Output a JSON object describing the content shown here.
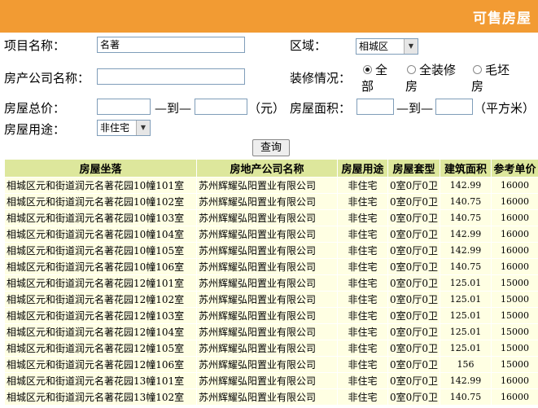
{
  "header": {
    "title": "可售房屋"
  },
  "form": {
    "project_name": {
      "label": "项目名称：",
      "value": "名著"
    },
    "region": {
      "label": "区域：",
      "value": "相城区"
    },
    "company": {
      "label": "房产公司名称：",
      "value": ""
    },
    "decoration": {
      "label": "装修情况：",
      "options": [
        {
          "line1": "全",
          "line2": "部",
          "selected": true
        },
        {
          "line1": "全装修",
          "line2": "房",
          "selected": false
        },
        {
          "line1": "毛坯",
          "line2": "房",
          "selected": false
        }
      ]
    },
    "total_price": {
      "label": "房屋总价：",
      "to": "—到—",
      "unit": "（元）",
      "min": "",
      "max": ""
    },
    "area": {
      "label": "房屋面积：",
      "to": "—到—",
      "unit": "（平方米）",
      "min": "",
      "max": ""
    },
    "usage": {
      "label": "房屋用途：",
      "value": "非住宅"
    },
    "search_button": "查询"
  },
  "table": {
    "headers": [
      "房屋坐落",
      "房地产公司名称",
      "房屋用途",
      "房屋套型",
      "建筑面积",
      "参考单价"
    ],
    "rows": [
      [
        "相城区元和街道润元名著花园10幢101室",
        "苏州辉耀弘阳置业有限公司",
        "非住宅",
        "0室0厅0卫",
        "142.99",
        "16000"
      ],
      [
        "相城区元和街道润元名著花园10幢102室",
        "苏州辉耀弘阳置业有限公司",
        "非住宅",
        "0室0厅0卫",
        "140.75",
        "16000"
      ],
      [
        "相城区元和街道润元名著花园10幢103室",
        "苏州辉耀弘阳置业有限公司",
        "非住宅",
        "0室0厅0卫",
        "140.75",
        "16000"
      ],
      [
        "相城区元和街道润元名著花园10幢104室",
        "苏州辉耀弘阳置业有限公司",
        "非住宅",
        "0室0厅0卫",
        "142.99",
        "16000"
      ],
      [
        "相城区元和街道润元名著花园10幢105室",
        "苏州辉耀弘阳置业有限公司",
        "非住宅",
        "0室0厅0卫",
        "142.99",
        "16000"
      ],
      [
        "相城区元和街道润元名著花园10幢106室",
        "苏州辉耀弘阳置业有限公司",
        "非住宅",
        "0室0厅0卫",
        "140.75",
        "16000"
      ],
      [
        "相城区元和街道润元名著花园12幢101室",
        "苏州辉耀弘阳置业有限公司",
        "非住宅",
        "0室0厅0卫",
        "125.01",
        "15000"
      ],
      [
        "相城区元和街道润元名著花园12幢102室",
        "苏州辉耀弘阳置业有限公司",
        "非住宅",
        "0室0厅0卫",
        "125.01",
        "15000"
      ],
      [
        "相城区元和街道润元名著花园12幢103室",
        "苏州辉耀弘阳置业有限公司",
        "非住宅",
        "0室0厅0卫",
        "125.01",
        "15000"
      ],
      [
        "相城区元和街道润元名著花园12幢104室",
        "苏州辉耀弘阳置业有限公司",
        "非住宅",
        "0室0厅0卫",
        "125.01",
        "15000"
      ],
      [
        "相城区元和街道润元名著花园12幢105室",
        "苏州辉耀弘阳置业有限公司",
        "非住宅",
        "0室0厅0卫",
        "125.01",
        "15000"
      ],
      [
        "相城区元和街道润元名著花园12幢106室",
        "苏州辉耀弘阳置业有限公司",
        "非住宅",
        "0室0厅0卫",
        "156",
        "15000"
      ],
      [
        "相城区元和街道润元名著花园13幢101室",
        "苏州辉耀弘阳置业有限公司",
        "非住宅",
        "0室0厅0卫",
        "142.99",
        "16000"
      ],
      [
        "相城区元和街道润元名著花园13幢102室",
        "苏州辉耀弘阳置业有限公司",
        "非住宅",
        "0室0厅0卫",
        "140.75",
        "16000"
      ]
    ]
  },
  "colors": {
    "header_bar": "#f29b33",
    "table_header": "#dde79c",
    "table_cell": "#ffffe3"
  }
}
